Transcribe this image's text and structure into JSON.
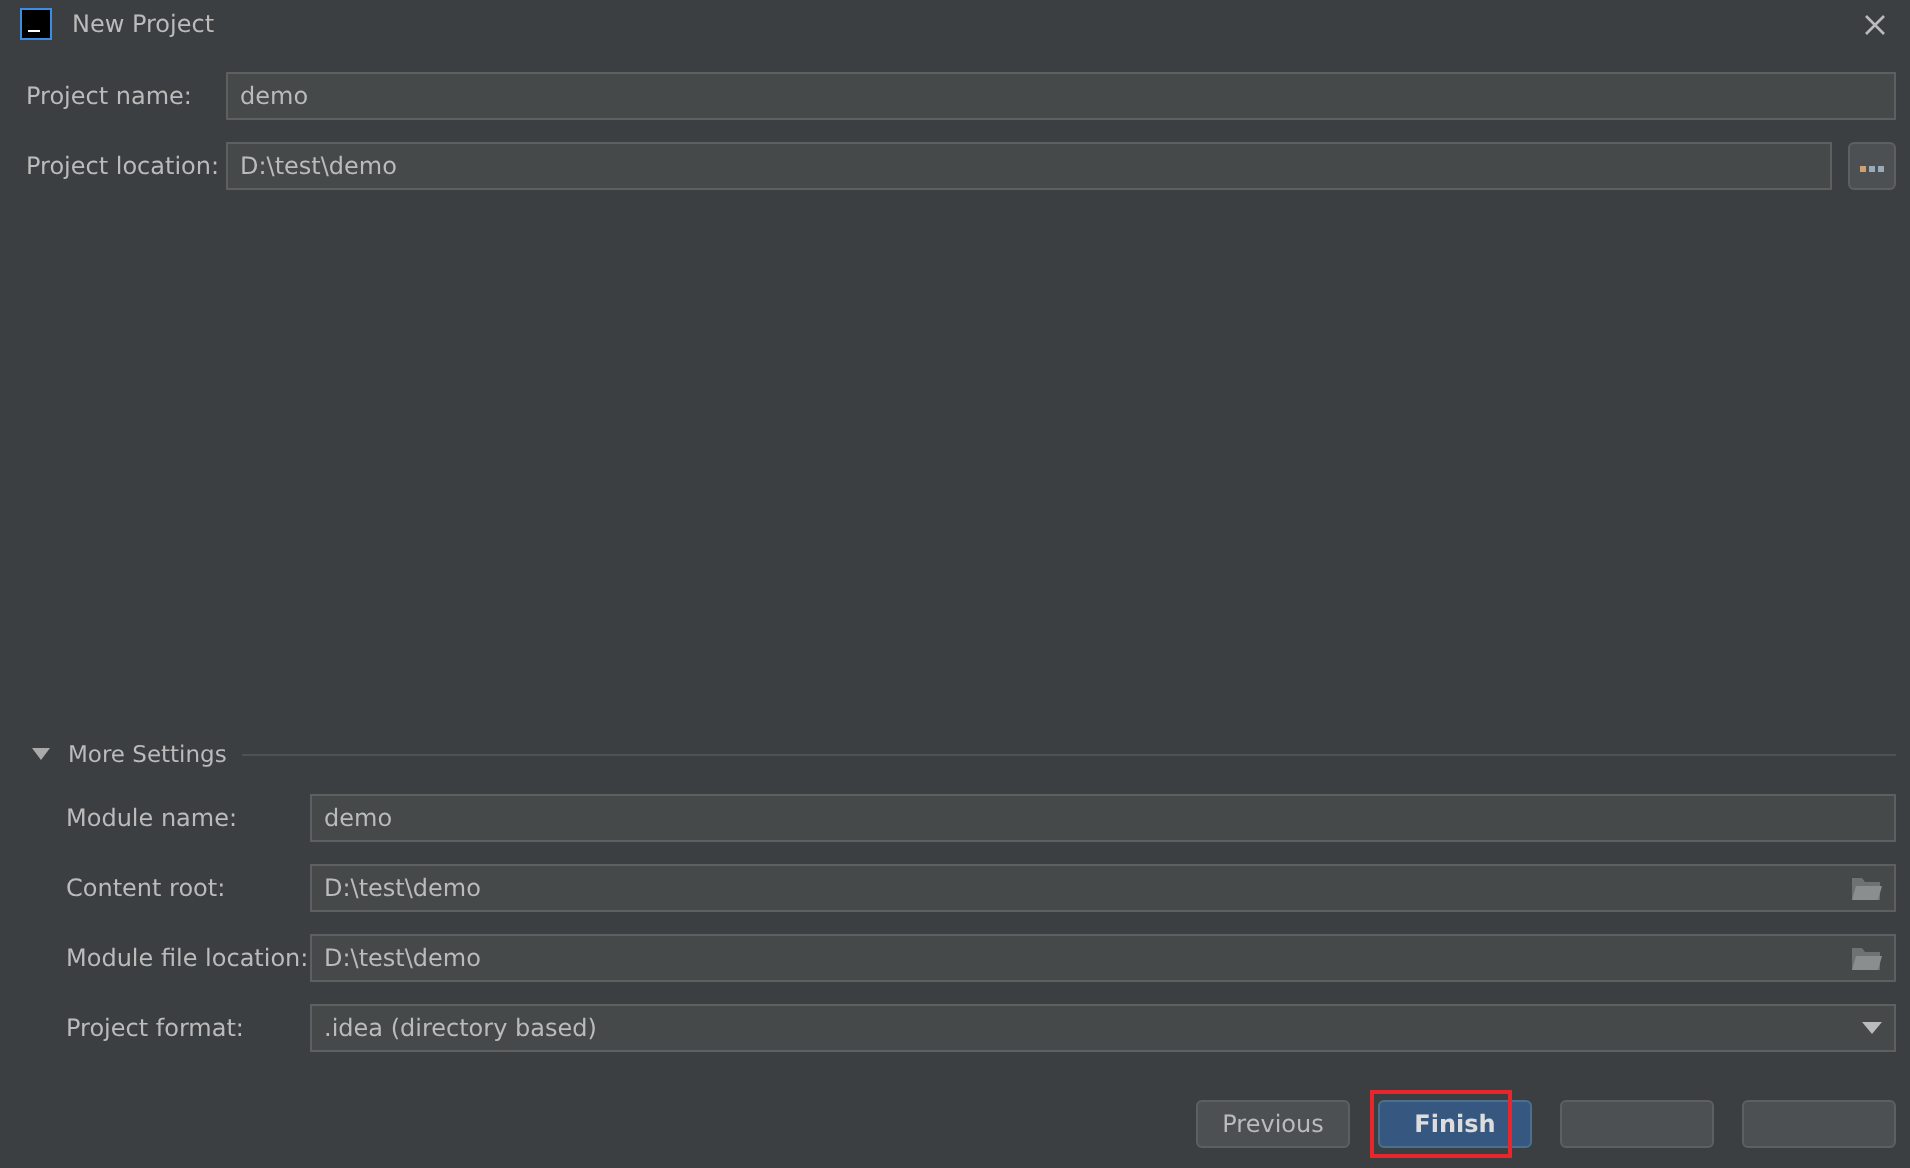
{
  "window": {
    "title": "New Project"
  },
  "project_fields": [
    {
      "label": "Project name:",
      "value": "demo",
      "kind": "text"
    },
    {
      "label": "Project location:",
      "value": "D:\\test\\demo",
      "kind": "browse"
    }
  ],
  "more_settings": {
    "label": "More Settings",
    "expanded": true,
    "fields": [
      {
        "label": "Module name:",
        "value": "demo",
        "kind": "text"
      },
      {
        "label": "Content root:",
        "value": "D:\\test\\demo",
        "kind": "folder"
      },
      {
        "label": "Module file location:",
        "value": "D:\\test\\demo",
        "kind": "folder"
      },
      {
        "label": "Project format:",
        "value": ".idea (directory based)",
        "kind": "dropdown"
      }
    ]
  },
  "buttons": [
    {
      "label": "Previous",
      "primary": false,
      "highlighted": false
    },
    {
      "label": "Finish",
      "primary": true,
      "highlighted": true
    },
    {
      "primary": false,
      "highlighted": false
    },
    {
      "primary": false,
      "highlighted": false
    }
  ]
}
